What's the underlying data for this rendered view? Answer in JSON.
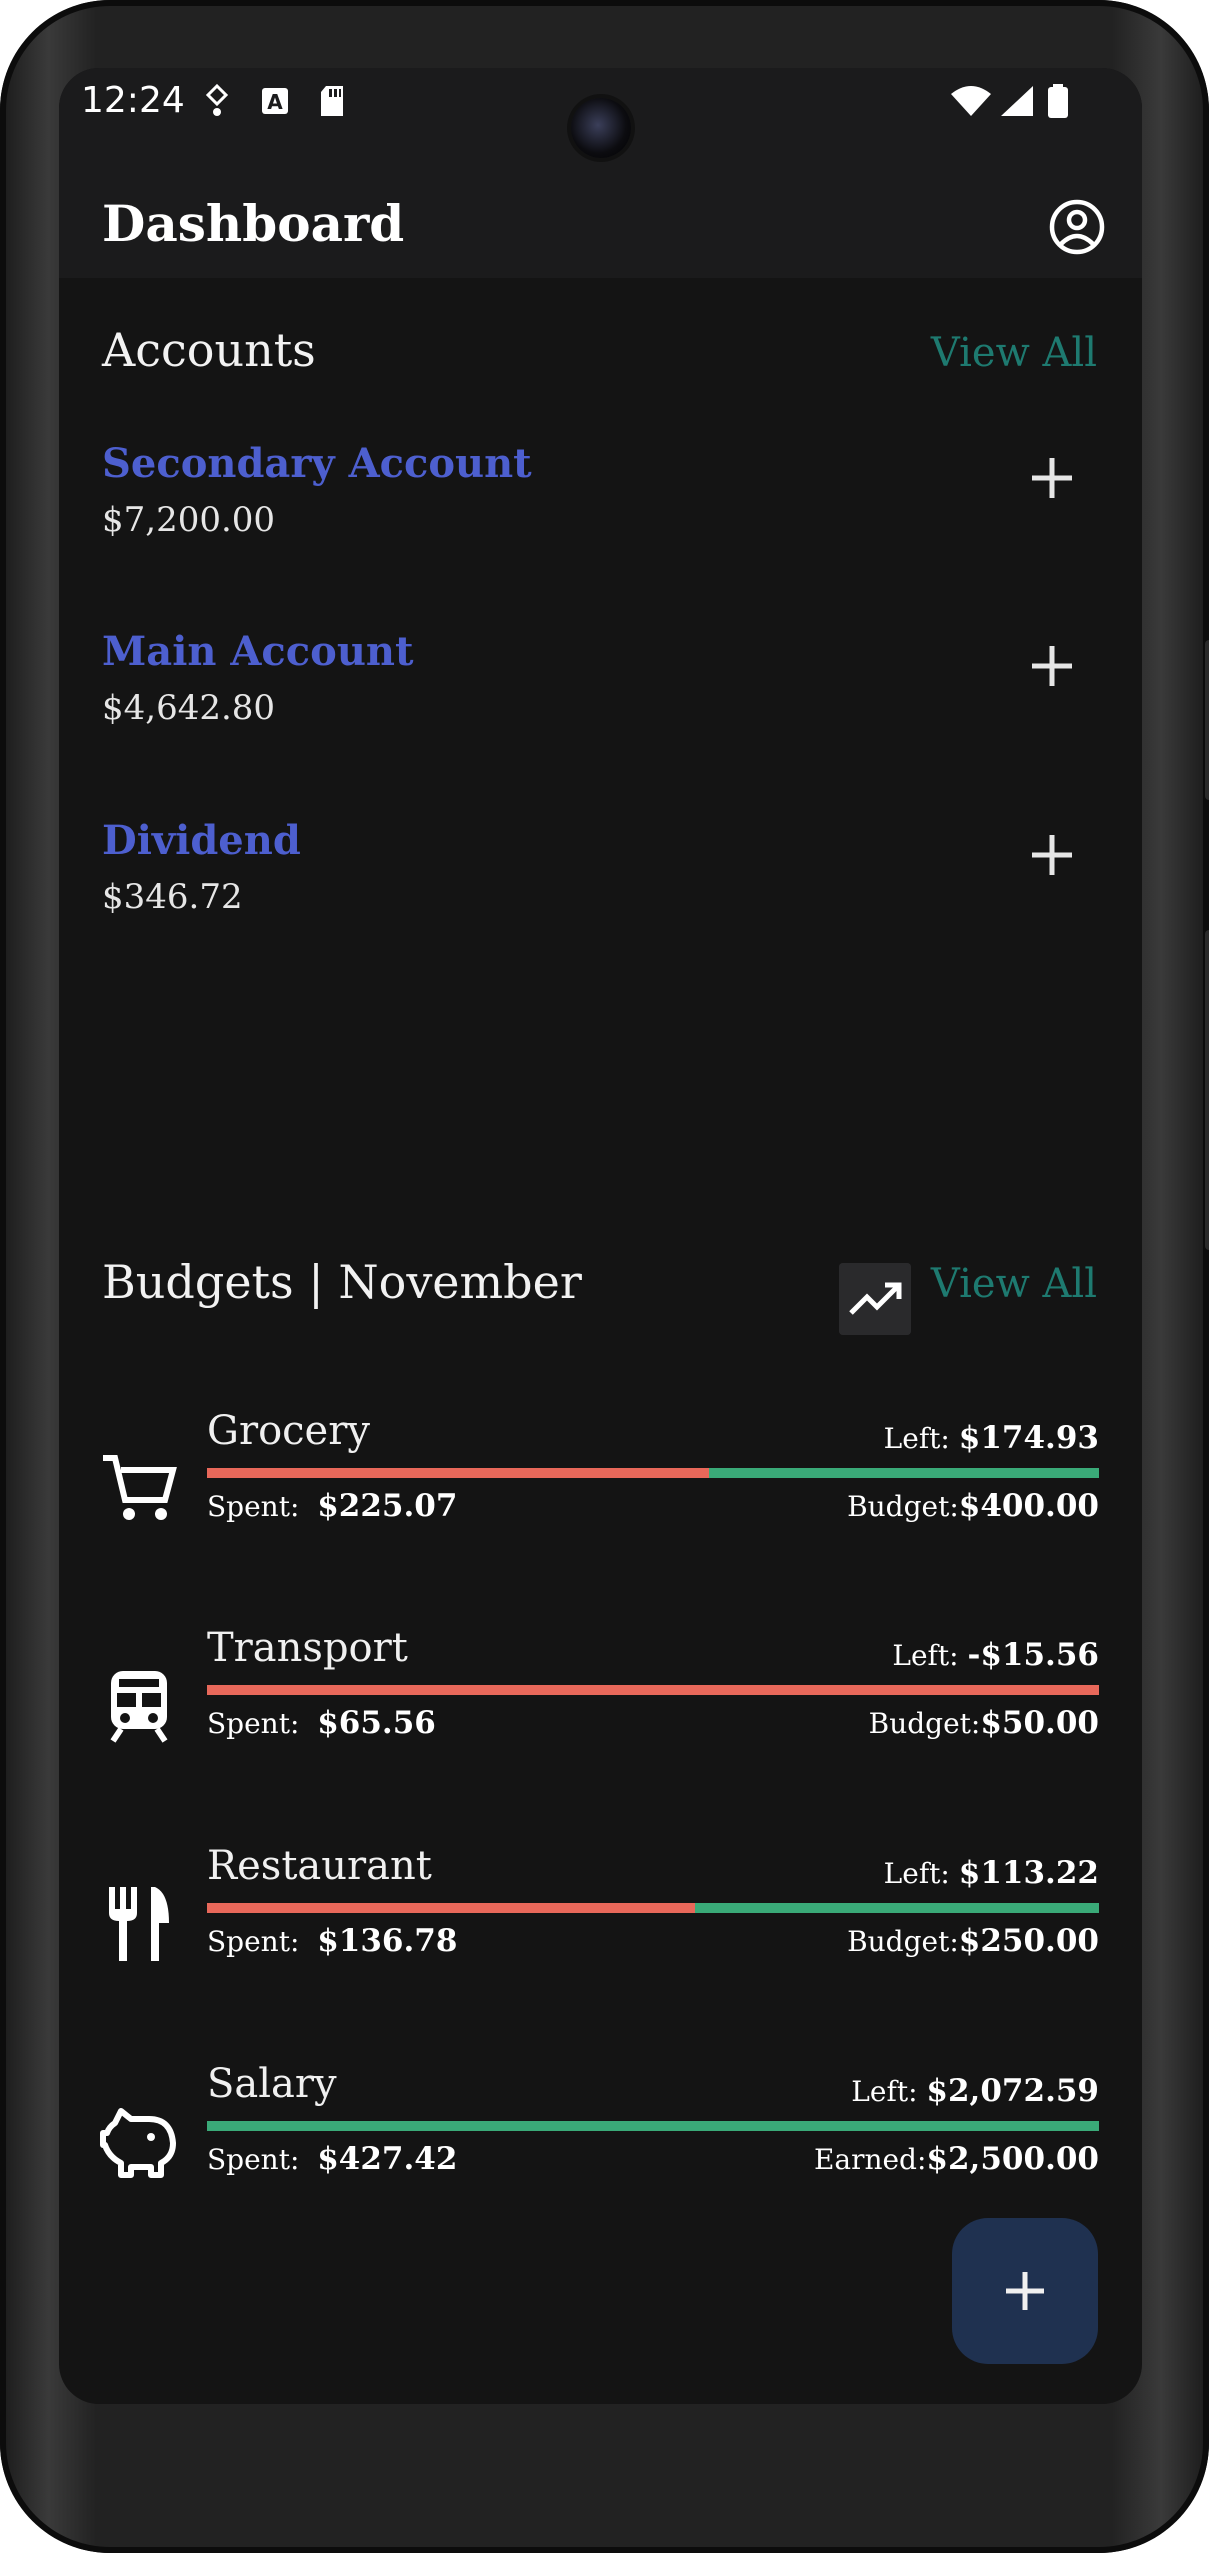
{
  "status_bar": {
    "time": "12:24"
  },
  "app_bar": {
    "title": "Dashboard",
    "profile_icon": "account-circle-icon"
  },
  "accounts": {
    "title": "Accounts",
    "view_all": "View All",
    "items": [
      {
        "name": "Secondary Account",
        "balance": "$7,200.00"
      },
      {
        "name": "Main Account",
        "balance": "$4,642.80"
      },
      {
        "name": "Dividend",
        "balance": "$346.72"
      }
    ]
  },
  "budgets": {
    "title": "Budgets | November",
    "view_all": "View All",
    "items": [
      {
        "name": "Grocery",
        "icon": "cart-icon",
        "left_label": "Left:",
        "left": "$174.93",
        "spent_label": "Spent:",
        "spent": "$225.07",
        "budget_label": "Budget:",
        "budget": "$400.00",
        "spent_fraction": 0.5627
      },
      {
        "name": "Transport",
        "icon": "train-icon",
        "left_label": "Left:",
        "left": "-$15.56",
        "spent_label": "Spent:",
        "spent": "$65.56",
        "budget_label": "Budget:",
        "budget": "$50.00",
        "spent_fraction": 1.0
      },
      {
        "name": "Restaurant",
        "icon": "fork-knife-icon",
        "left_label": "Left:",
        "left": "$113.22",
        "spent_label": "Spent:",
        "spent": "$136.78",
        "budget_label": "Budget:",
        "budget": "$250.00",
        "spent_fraction": 0.5471
      },
      {
        "name": "Salary",
        "icon": "piggy-bank-icon",
        "left_label": "Left:",
        "left": "$2,072.59",
        "spent_label": "Spent:",
        "spent": "$427.42",
        "budget_label": "Earned:",
        "budget": "$2,500.00",
        "spent_fraction": 0.0
      }
    ]
  },
  "colors": {
    "accent_blue": "#4d5fcf",
    "view_all": "#1e7a70",
    "spent": "#e8685a",
    "remaining": "#3aaa78",
    "fab": "#1f3150"
  }
}
